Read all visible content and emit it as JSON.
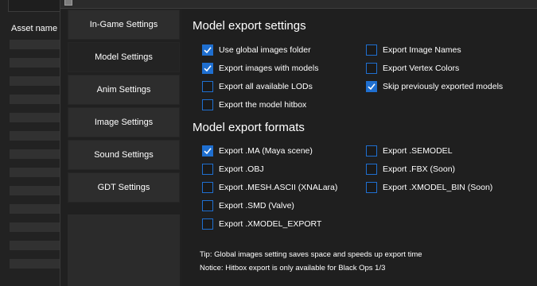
{
  "background_app": {
    "column_header": "Asset name"
  },
  "sidebar": {
    "items": [
      {
        "label": "In-Game Settings",
        "active": false
      },
      {
        "label": "Model Settings",
        "active": true
      },
      {
        "label": "Anim Settings",
        "active": false
      },
      {
        "label": "Image Settings",
        "active": false
      },
      {
        "label": "Sound Settings",
        "active": false
      },
      {
        "label": "GDT Settings",
        "active": false
      }
    ]
  },
  "export_settings": {
    "title": "Model export settings",
    "options": [
      {
        "label": "Use global images folder",
        "checked": true
      },
      {
        "label": "Export images with models",
        "checked": true
      },
      {
        "label": "Export all available LODs",
        "checked": false
      },
      {
        "label": "Export the model hitbox",
        "checked": false
      },
      {
        "label": "Export Image Names",
        "checked": false
      },
      {
        "label": "Export Vertex Colors",
        "checked": false
      },
      {
        "label": "Skip previously exported models",
        "checked": true
      }
    ]
  },
  "export_formats": {
    "title": "Model export formats",
    "options": [
      {
        "label": "Export .MA (Maya scene)",
        "checked": true
      },
      {
        "label": "Export .OBJ",
        "checked": false
      },
      {
        "label": "Export .MESH.ASCII (XNALara)",
        "checked": false
      },
      {
        "label": "Export .SMD (Valve)",
        "checked": false
      },
      {
        "label": "Export .XMODEL_EXPORT",
        "checked": false
      },
      {
        "label": "Export .SEMODEL",
        "checked": false
      },
      {
        "label": "Export .FBX (Soon)",
        "checked": false
      },
      {
        "label": "Export .XMODEL_BIN (Soon)",
        "checked": false
      }
    ]
  },
  "tips": {
    "tip": "Tip: Global images setting saves space and speeds up export time",
    "notice": "Notice: Hitbox export is only available for Black Ops 1/3"
  },
  "colors": {
    "accent": "#1f6fd0",
    "dialog_bg": "#202020",
    "sidebar_button": "#2d2d2d"
  }
}
